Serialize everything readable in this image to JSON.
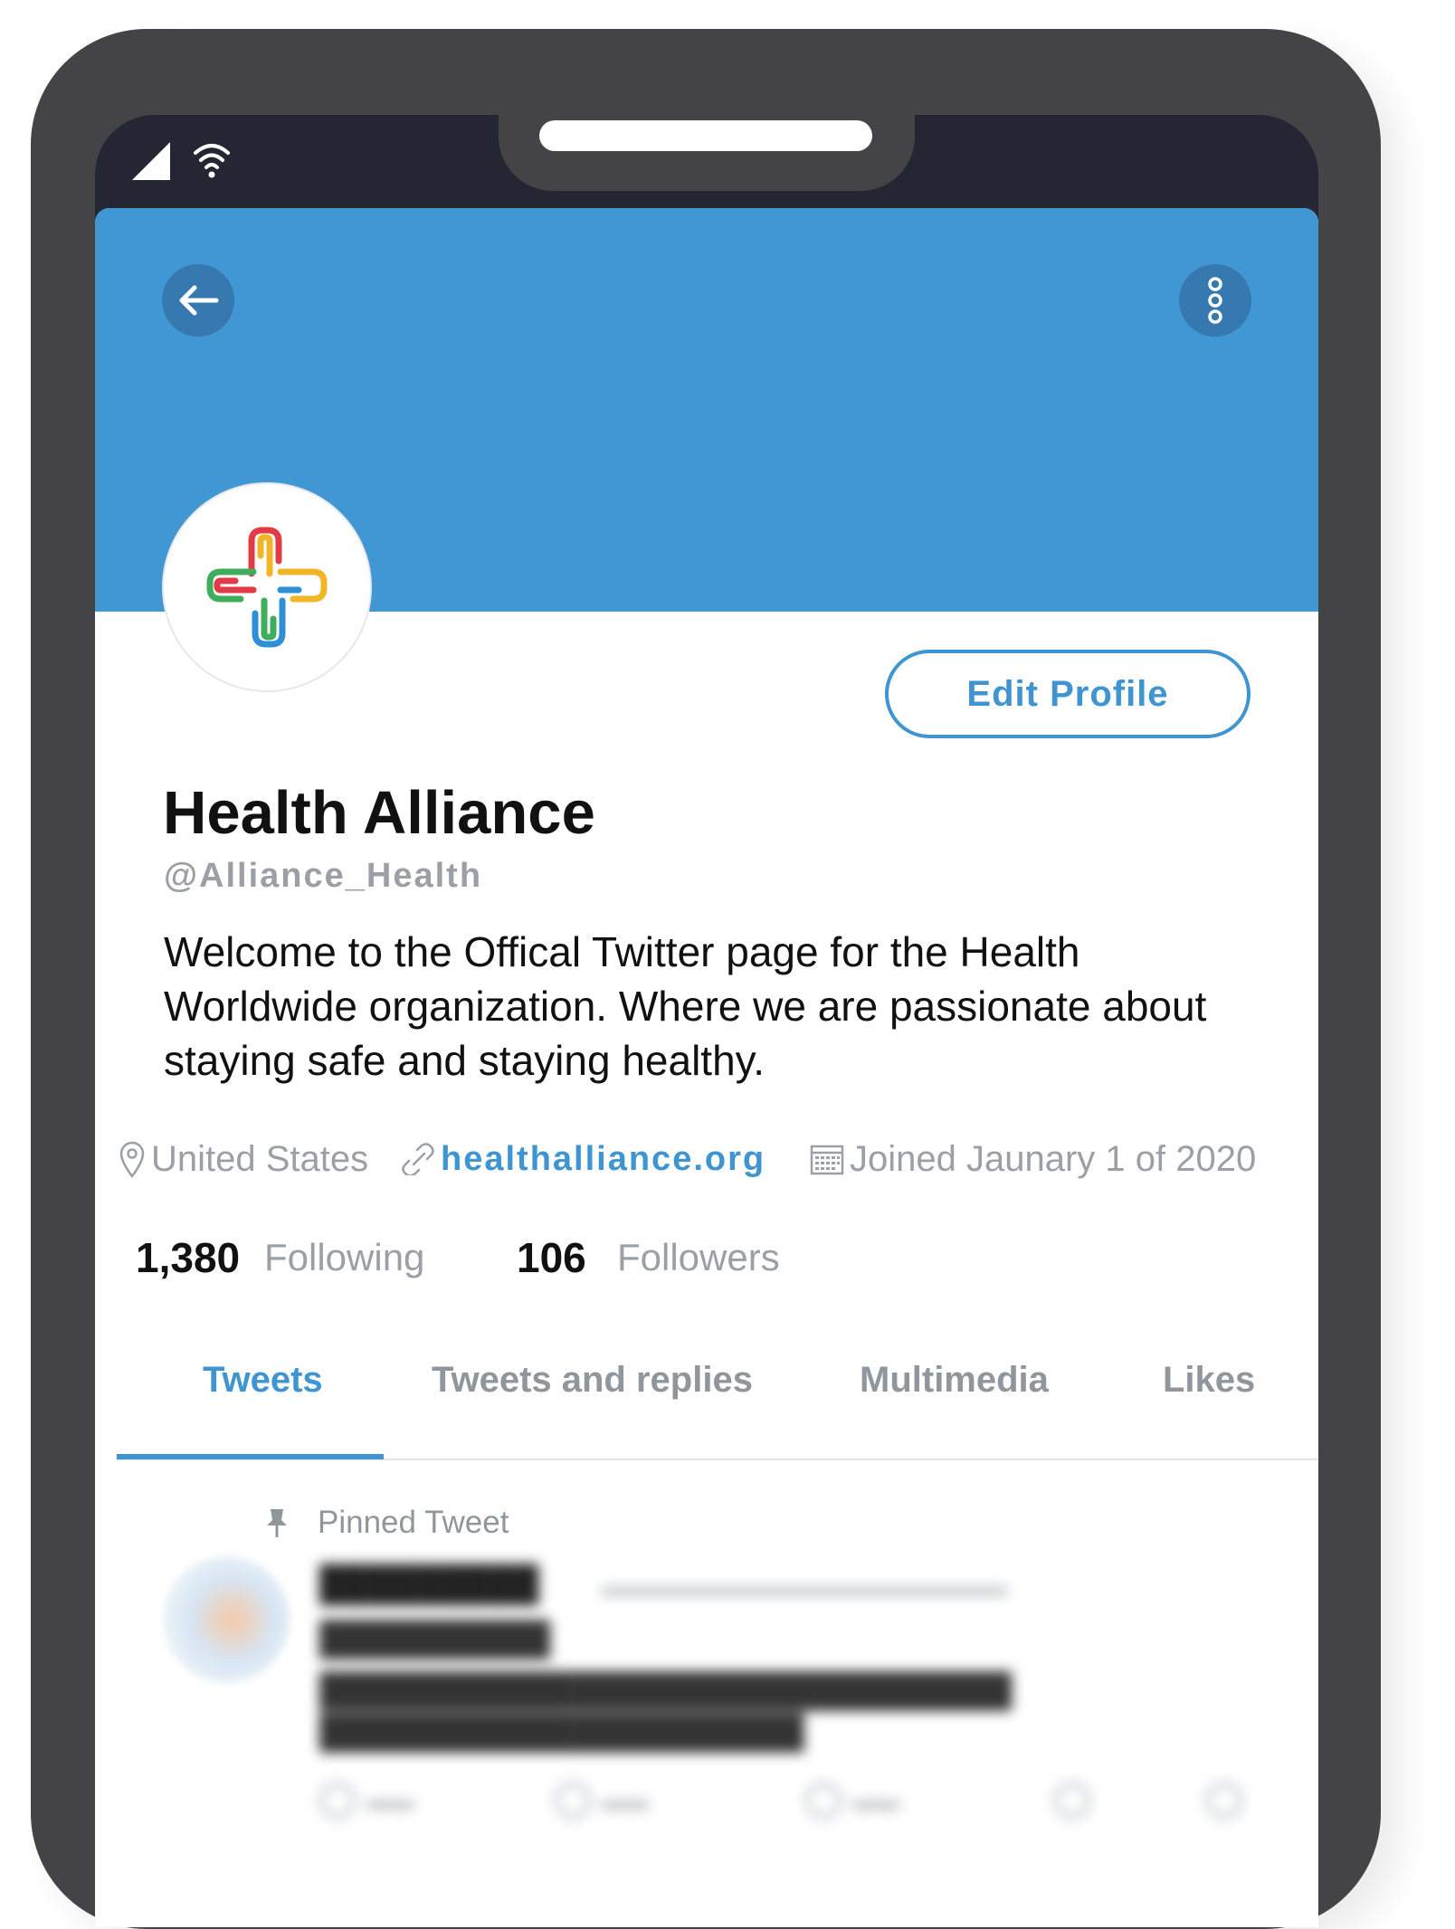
{
  "profile": {
    "name": "Health Alliance",
    "handle": "@Alliance_Health",
    "bio": "Welcome to the Offical Twitter page for the Health Worldwide organization. Where we are passionate about staying safe and staying healthy.",
    "location": "United States",
    "website": "healthalliance.org",
    "joined": "Joined Jaunary 1 of 2020",
    "edit_button_label": "Edit Profile",
    "following_count": "1,380",
    "following_label": "Following",
    "followers_count": "106",
    "followers_label": "Followers"
  },
  "tabs": {
    "tweets": "Tweets",
    "tweets_and_replies": "Tweets and replies",
    "multimedia": "Multimedia",
    "likes": "Likes",
    "active": "Tweets"
  },
  "pinned": {
    "label": "Pinned Tweet"
  },
  "icons": {
    "back": "arrow-left-icon",
    "more": "more-vertical-icon",
    "location": "map-pin-icon",
    "link": "link-icon",
    "calendar": "calendar-icon",
    "pin": "pin-icon",
    "signal": "cell-signal-icon",
    "wifi": "wifi-icon"
  },
  "colors": {
    "banner": "#4097d3",
    "accent": "#3e95d1",
    "phone_frame": "#444446",
    "muted_text": "#9aa0a6"
  }
}
